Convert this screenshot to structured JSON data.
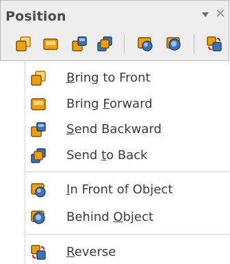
{
  "toolbar": {
    "title": "Position",
    "menu_glyph": "▼",
    "close_glyph": "×",
    "buttons": [
      {
        "icon": "bring-to-front-icon"
      },
      {
        "icon": "bring-forward-icon"
      },
      {
        "icon": "send-backward-icon"
      },
      {
        "icon": "send-to-back-icon"
      },
      {
        "icon": "in-front-of-object-icon"
      },
      {
        "icon": "behind-object-icon"
      },
      {
        "icon": "reverse-icon"
      }
    ]
  },
  "menu": {
    "items": [
      {
        "pre": "",
        "key": "B",
        "post": "ring to Front",
        "icon": "bring-to-front-icon"
      },
      {
        "pre": "Bring ",
        "key": "F",
        "post": "orward",
        "icon": "bring-forward-icon"
      },
      {
        "pre": "",
        "key": "S",
        "post": "end Backward",
        "icon": "send-backward-icon"
      },
      {
        "pre": "Send ",
        "key": "t",
        "post": "o Back",
        "icon": "send-to-back-icon"
      },
      {
        "pre": "",
        "key": "I",
        "post": "n Front of Object",
        "icon": "in-front-of-object-icon"
      },
      {
        "pre": "Behind ",
        "key": "O",
        "post": "bject",
        "icon": "behind-object-icon"
      },
      {
        "pre": "",
        "key": "R",
        "post": "everse",
        "icon": "reverse-icon"
      }
    ]
  },
  "colors": {
    "orange": "#f0a000",
    "orange_light": "#fcd27a",
    "blue": "#3f73b6",
    "blue_light": "#9cc3ee",
    "red": "#d62020"
  }
}
